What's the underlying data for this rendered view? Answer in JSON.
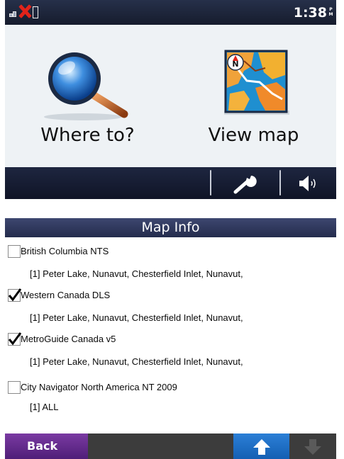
{
  "status": {
    "time": "1:38",
    "ampm": [
      "P",
      "M"
    ]
  },
  "main_menu": {
    "where_to_label": "Where to?",
    "view_map_label": "View map"
  },
  "icons": {
    "magnifier": "magnifier-icon",
    "map": "map-icon",
    "wrench": "wrench-icon",
    "speaker": "speaker-icon",
    "map_compass_letter": "N"
  },
  "map_info": {
    "title": "Map Info",
    "items": [
      {
        "name": "British Columbia NTS",
        "checked": false,
        "detail": "[1] Peter Lake, Nunavut, Chesterfield Inlet, Nunavut,"
      },
      {
        "name": "Western Canada DLS",
        "checked": true,
        "detail": "[1] Peter Lake, Nunavut, Chesterfield Inlet, Nunavut,"
      },
      {
        "name": "MetroGuide Canada v5",
        "checked": true,
        "detail": "[1] Peter Lake, Nunavut, Chesterfield Inlet, Nunavut,"
      },
      {
        "name": "City Navigator North America NT 2009",
        "checked": false,
        "detail": "[1] ALL"
      }
    ],
    "back_label": "Back"
  },
  "colors": {
    "header_navy": "#242c4c",
    "back_purple": "#5e2a88",
    "up_blue": "#1e6fc8",
    "signal_red": "#e2231a"
  }
}
